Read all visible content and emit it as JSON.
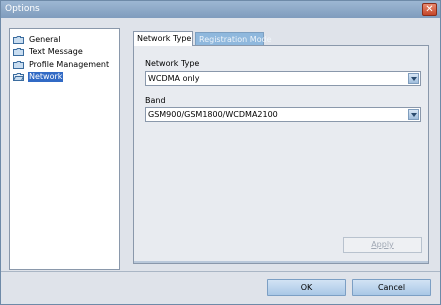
{
  "window": {
    "title": "Options"
  },
  "sidebar": {
    "items": [
      {
        "label": "General",
        "selected": false
      },
      {
        "label": "Text Message",
        "selected": false
      },
      {
        "label": "Profile Management",
        "selected": false
      },
      {
        "label": "Network",
        "selected": true
      }
    ]
  },
  "tabs": [
    {
      "label": "Network Type",
      "active": true
    },
    {
      "label": "Registration Mode",
      "active": false
    }
  ],
  "network": {
    "network_type_label": "Network Type",
    "network_type_value": "WCDMA only",
    "band_label": "Band",
    "band_value": "GSM900/GSM1800/WCDMA2100"
  },
  "buttons": {
    "apply": "Apply",
    "ok": "OK",
    "cancel": "Cancel"
  },
  "icons": {
    "folder": "folder-icon",
    "close": "close-icon",
    "dropdown": "chevron-down-icon"
  },
  "colors": {
    "selection": "#316ac5",
    "titlebar": "#7f9cbd",
    "close": "#c4462a"
  }
}
